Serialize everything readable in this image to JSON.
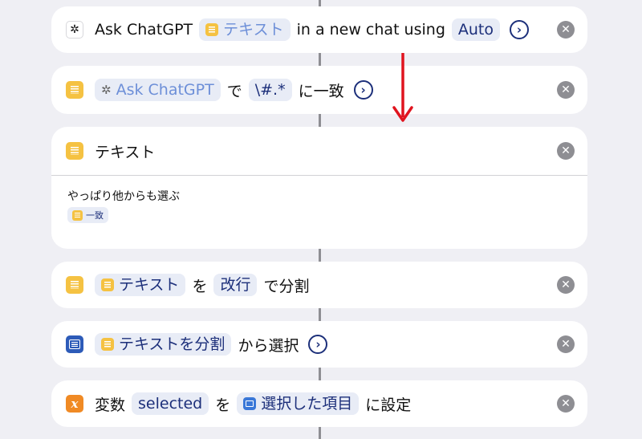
{
  "actions": [
    {
      "icon": "chatgpt-icon",
      "prefix": "Ask ChatGPT",
      "token1": "テキスト",
      "middle": "in a new chat using",
      "token2": "Auto"
    },
    {
      "icon": "text-icon",
      "token1": "Ask ChatGPT",
      "text1": "で",
      "token2": "\\#.*",
      "text2": "に一致"
    },
    {
      "icon": "text-icon",
      "title": "テキスト",
      "body": "やっぱり他からも選ぶ",
      "body_token": "一致"
    },
    {
      "icon": "text-icon",
      "token1": "テキスト",
      "text1": "を",
      "token2": "改行",
      "text2": "で分割"
    },
    {
      "icon": "list-icon",
      "token1": "テキストを分割",
      "text1": "から選択"
    },
    {
      "icon": "variable-icon",
      "icon_glyph": "x",
      "text1": "変数",
      "token1": "selected",
      "text2": "を",
      "token2": "選択した項目",
      "text3": "に設定"
    }
  ],
  "close_glyph": "✕",
  "chevron_glyph": "›",
  "colors": {
    "background": "#efeff4",
    "token_text": "#1c2f7a",
    "text_icon": "#f5c242",
    "variable_icon": "#f08a24",
    "arrow": "#e0141e"
  }
}
